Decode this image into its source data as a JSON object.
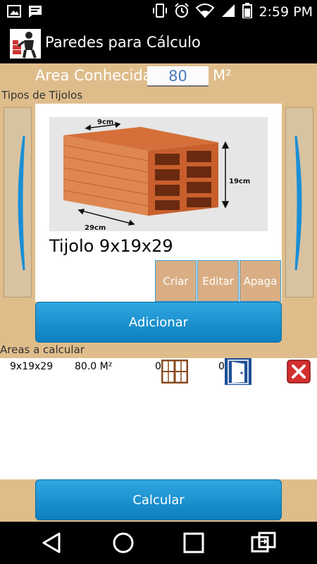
{
  "status_bar": {
    "time": "2:59 PM",
    "icons": [
      "image-icon",
      "message-icon",
      "phone-vibrate-icon",
      "alarm-icon",
      "wifi-icon",
      "signal-icon",
      "battery-icon"
    ]
  },
  "app": {
    "title": "Paredes para Cálculo"
  },
  "area": {
    "label": "Area Conhecida",
    "value": "80",
    "unit": "M²"
  },
  "tipos": {
    "label": "Tipos de Tijolos",
    "brick": {
      "name": "Tijolo 9x19x29",
      "dim_width": "9cm",
      "dim_height": "19cm",
      "dim_length": "29cm"
    },
    "buttons": {
      "criar": "Criar",
      "editar": "Editar",
      "apaga": "Apaga"
    }
  },
  "adicionar_label": "Adicionar",
  "areas": {
    "label": "Areas a calcular",
    "rows": [
      {
        "tijolo": "9x19x29",
        "area": "80.0 M²",
        "janelas": "0",
        "portas": "0"
      }
    ]
  },
  "calcular_label": "Calcular",
  "colors": {
    "content_bg": "#dfbd8b",
    "button_blue": "#1a93d3",
    "brick_button": "#d9ae84"
  }
}
